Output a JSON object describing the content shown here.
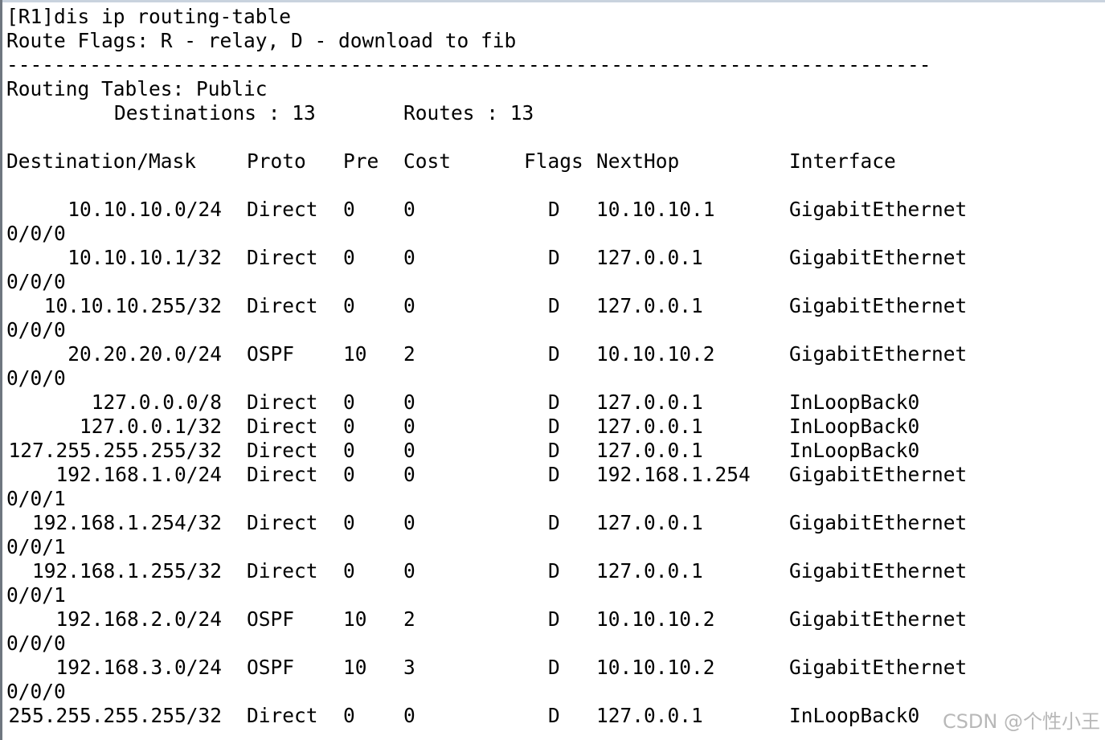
{
  "terminal": {
    "command": "[R1]dis ip routing-table",
    "flags_legend": "Route Flags: R - relay, D - download to fib",
    "separator": "------------------------------------------------------------------------------",
    "table_name": "Routing Tables: Public",
    "destinations_label": "Destinations : 13",
    "routes_label": "Routes : 13",
    "headers": {
      "dest": "Destination/Mask",
      "proto": "Proto",
      "pre": "Pre",
      "cost": "Cost",
      "flags": "Flags",
      "nexthop": "NextHop",
      "interface": "Interface"
    },
    "routes": [
      {
        "dest": "10.10.10.0/24",
        "proto": "Direct",
        "pre": "0",
        "cost": "0",
        "flags": "D",
        "nexthop": "10.10.10.1",
        "interface": "GigabitEthernet",
        "wrap": "0/0/0"
      },
      {
        "dest": "10.10.10.1/32",
        "proto": "Direct",
        "pre": "0",
        "cost": "0",
        "flags": "D",
        "nexthop": "127.0.0.1",
        "interface": "GigabitEthernet",
        "wrap": "0/0/0"
      },
      {
        "dest": "10.10.10.255/32",
        "proto": "Direct",
        "pre": "0",
        "cost": "0",
        "flags": "D",
        "nexthop": "127.0.0.1",
        "interface": "GigabitEthernet",
        "wrap": "0/0/0"
      },
      {
        "dest": "20.20.20.0/24",
        "proto": "OSPF",
        "pre": "10",
        "cost": "2",
        "flags": "D",
        "nexthop": "10.10.10.2",
        "interface": "GigabitEthernet",
        "wrap": "0/0/0"
      },
      {
        "dest": "127.0.0.0/8",
        "proto": "Direct",
        "pre": "0",
        "cost": "0",
        "flags": "D",
        "nexthop": "127.0.0.1",
        "interface": "InLoopBack0",
        "wrap": ""
      },
      {
        "dest": "127.0.0.1/32",
        "proto": "Direct",
        "pre": "0",
        "cost": "0",
        "flags": "D",
        "nexthop": "127.0.0.1",
        "interface": "InLoopBack0",
        "wrap": ""
      },
      {
        "dest": "127.255.255.255/32",
        "proto": "Direct",
        "pre": "0",
        "cost": "0",
        "flags": "D",
        "nexthop": "127.0.0.1",
        "interface": "InLoopBack0",
        "wrap": ""
      },
      {
        "dest": "192.168.1.0/24",
        "proto": "Direct",
        "pre": "0",
        "cost": "0",
        "flags": "D",
        "nexthop": "192.168.1.254",
        "interface": "GigabitEthernet",
        "wrap": "0/0/1"
      },
      {
        "dest": "192.168.1.254/32",
        "proto": "Direct",
        "pre": "0",
        "cost": "0",
        "flags": "D",
        "nexthop": "127.0.0.1",
        "interface": "GigabitEthernet",
        "wrap": "0/0/1"
      },
      {
        "dest": "192.168.1.255/32",
        "proto": "Direct",
        "pre": "0",
        "cost": "0",
        "flags": "D",
        "nexthop": "127.0.0.1",
        "interface": "GigabitEthernet",
        "wrap": "0/0/1"
      },
      {
        "dest": "192.168.2.0/24",
        "proto": "OSPF",
        "pre": "10",
        "cost": "2",
        "flags": "D",
        "nexthop": "10.10.10.2",
        "interface": "GigabitEthernet",
        "wrap": "0/0/0"
      },
      {
        "dest": "192.168.3.0/24",
        "proto": "OSPF",
        "pre": "10",
        "cost": "3",
        "flags": "D",
        "nexthop": "10.10.10.2",
        "interface": "GigabitEthernet",
        "wrap": "0/0/0"
      },
      {
        "dest": "255.255.255.255/32",
        "proto": "Direct",
        "pre": "0",
        "cost": "0",
        "flags": "D",
        "nexthop": "127.0.0.1",
        "interface": "InLoopBack0",
        "wrap": ""
      }
    ]
  },
  "watermark": "CSDN @个性小王"
}
